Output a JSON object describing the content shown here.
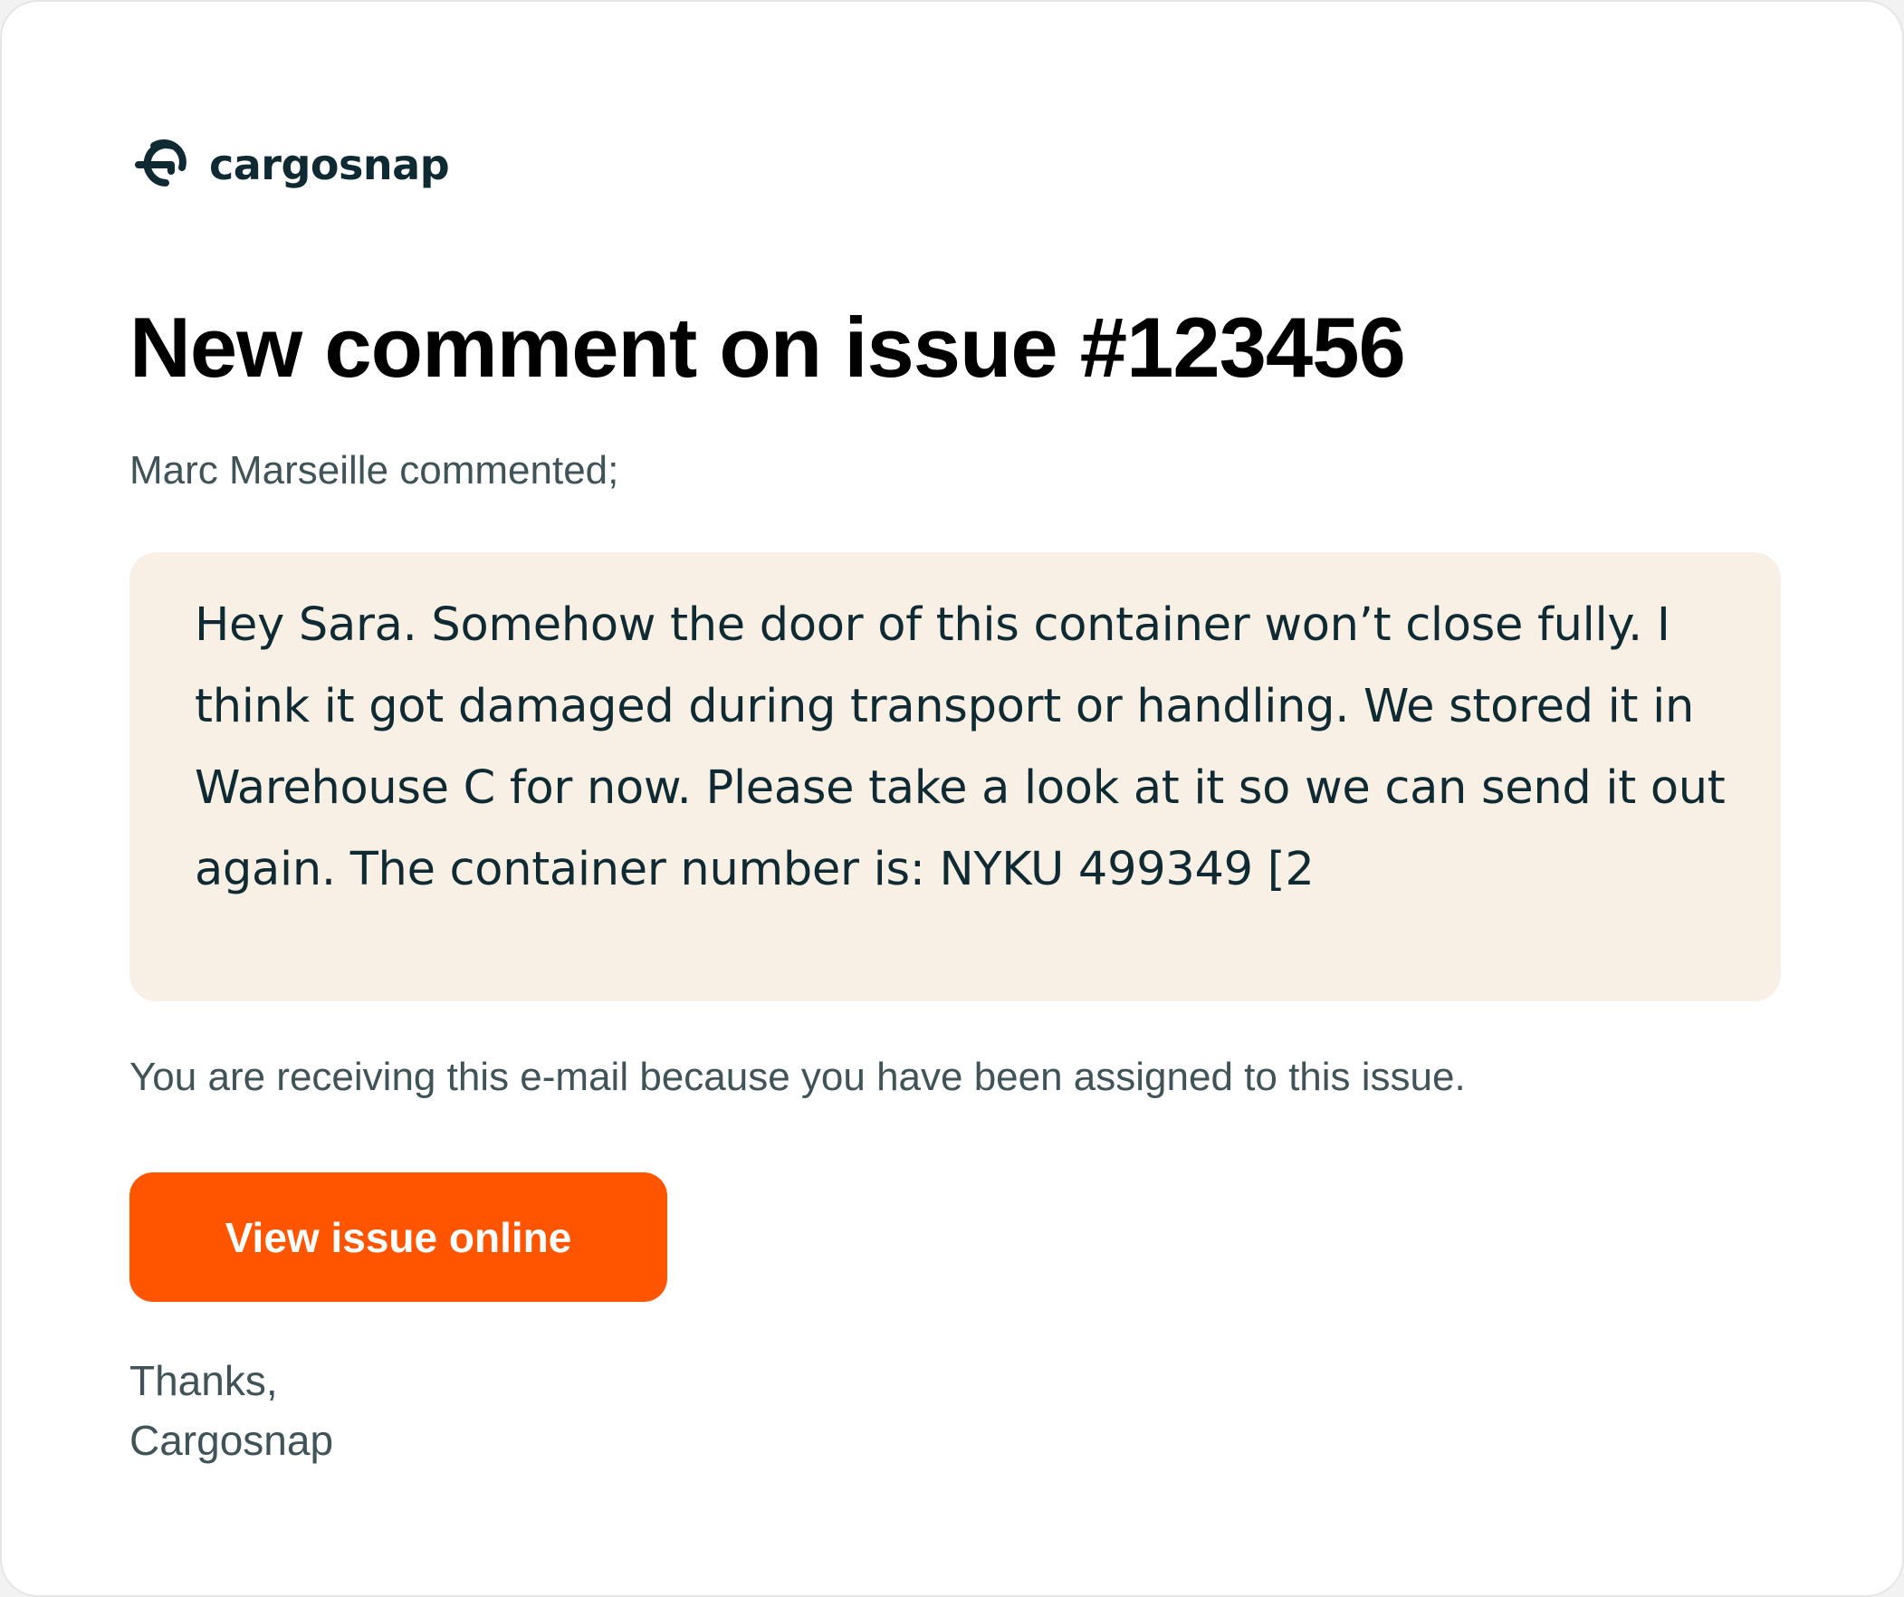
{
  "brand": {
    "logo_icon": "cargosnap-logo-icon",
    "name": "cargosnap"
  },
  "email": {
    "title": "New comment on issue #123456",
    "intro": "Marc Marseille commented;",
    "comment": "Hey Sara. Somehow the door of this container won’t close fully. I think it got damaged during transport or handling. We stored it in Warehouse C for now. Please take a look at it so we can send it out again. The container number is: NYKU 499349 [2",
    "notice": "You are receiving this e-mail because you have been assigned to this issue.",
    "cta_label": "View issue online",
    "signoff_line1": "Thanks,",
    "signoff_line2": "Cargosnap"
  },
  "colors": {
    "brand_dark": "#0f2a33",
    "accent": "#ff5400",
    "comment_bg": "#f8f0e4",
    "body_text": "#3f5358"
  }
}
